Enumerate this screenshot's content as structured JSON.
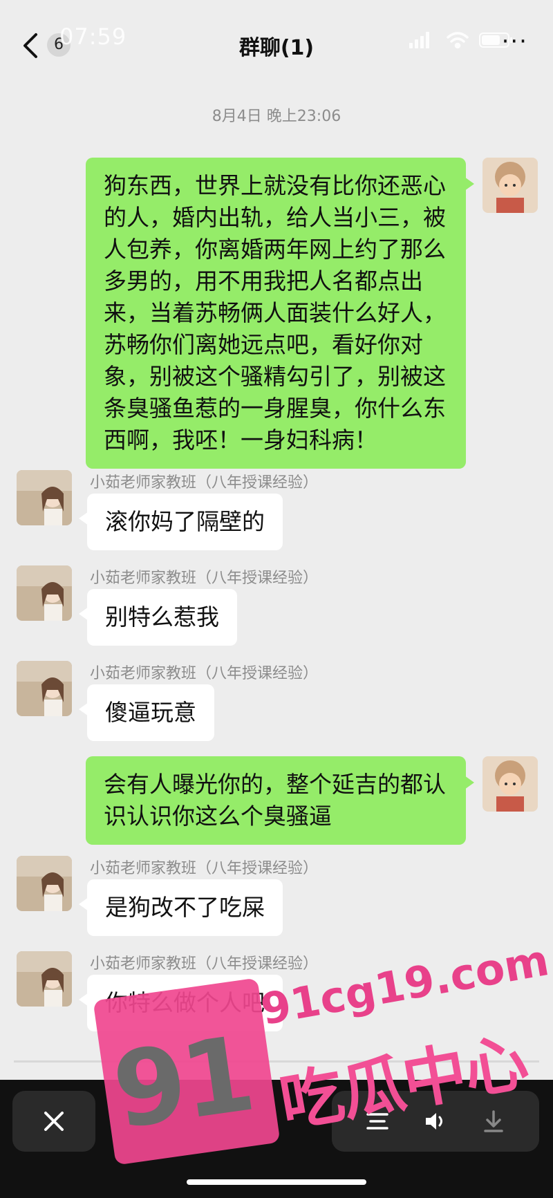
{
  "status_bar": {
    "time": "07:59"
  },
  "header": {
    "back_count": "6",
    "title": "群聊(1)",
    "more": "···"
  },
  "chat": {
    "timestamp": "8月4日 晚上23:06",
    "messages": [
      {
        "side": "right",
        "text": "狗东西，世界上就没有比你还恶心的人，婚内出轨，给人当小三，被人包养，你离婚两年网上约了那么多男的，用不用我把人名都点出来，当着苏畅俩人面装什么好人，苏畅你们离她远点吧，看好你对象，别被这个骚精勾引了，别被这条臭骚鱼惹的一身腥臭，你什么东西啊，我呸！一身妇科病！"
      },
      {
        "side": "left",
        "sender": "小茹老师家教班（八年授课经验）",
        "text": "滚你妈了隔壁的"
      },
      {
        "side": "left",
        "sender": "小茹老师家教班（八年授课经验）",
        "text": "别特么惹我"
      },
      {
        "side": "left",
        "sender": "小茹老师家教班（八年授课经验）",
        "text": "傻逼玩意"
      },
      {
        "side": "right",
        "text": "会有人曝光你的，整个延吉的都认识认识你这么个臭骚逼"
      },
      {
        "side": "left",
        "sender": "小茹老师家教班（八年授课经验）",
        "text": "是狗改不了吃屎"
      },
      {
        "side": "left",
        "sender": "小茹老师家教班（八年授课经验）",
        "text": "你特么做个人吧"
      }
    ]
  },
  "watermark": {
    "number": "91",
    "site": "91cg19.com",
    "name": "吃瓜中心"
  },
  "colors": {
    "self_bubble": "#95ec69",
    "other_bubble": "#ffffff",
    "background": "#ededed",
    "watermark": "#f0478f"
  }
}
